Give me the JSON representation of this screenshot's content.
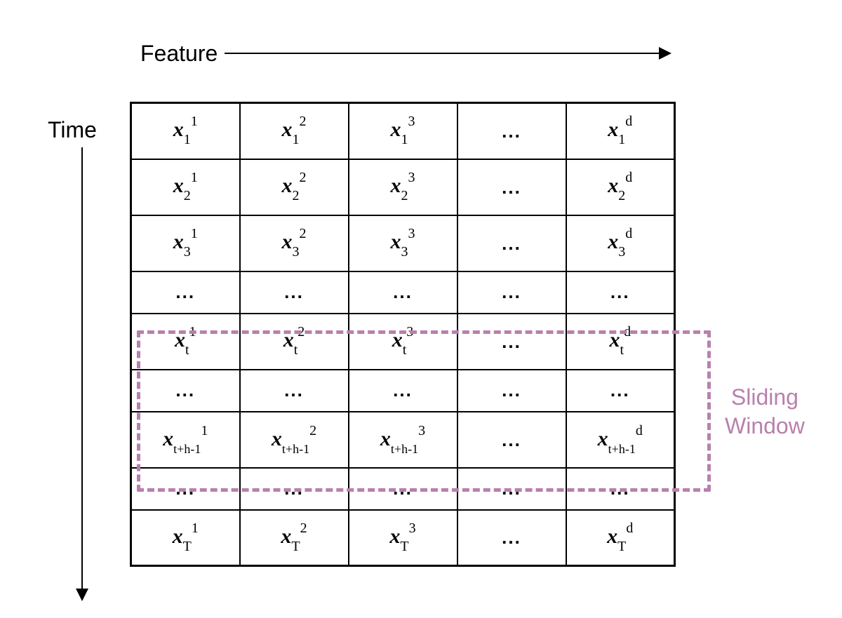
{
  "labels": {
    "feature": "Feature",
    "time": "Time",
    "sliding_line1": "Sliding",
    "sliding_line2": "Window"
  },
  "matrix": {
    "variable": "x",
    "rows": [
      {
        "type": "data",
        "sub": "1"
      },
      {
        "type": "data",
        "sub": "2"
      },
      {
        "type": "data",
        "sub": "3"
      },
      {
        "type": "dots"
      },
      {
        "type": "data",
        "sub": "t"
      },
      {
        "type": "dots"
      },
      {
        "type": "data",
        "sub": "t+h-1"
      },
      {
        "type": "dots"
      },
      {
        "type": "data",
        "sub": "T"
      }
    ],
    "cols": [
      "1",
      "2",
      "3",
      "...",
      "d"
    ],
    "dots": "..."
  },
  "sliding_window": {
    "start_row_index": 4,
    "end_row_index": 6
  }
}
